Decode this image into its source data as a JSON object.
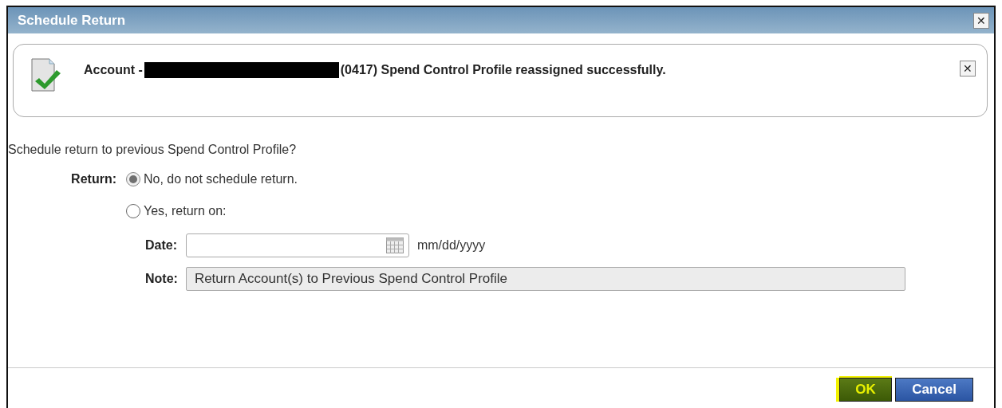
{
  "window": {
    "title": "Schedule Return",
    "close": "✕"
  },
  "message": {
    "prefix": "Account - ",
    "redacted": true,
    "text": "(0417) Spend Control Profile reassigned successfully.",
    "close": "✕"
  },
  "question": "Schedule return to previous Spend Control Profile?",
  "return": {
    "label": "Return:",
    "options": [
      {
        "label": "No, do not schedule return.",
        "selected": true
      },
      {
        "label": "Yes, return on:",
        "selected": false
      }
    ]
  },
  "date": {
    "label": "Date:",
    "format": "mm/dd/yyyy"
  },
  "note": {
    "label": "Note:",
    "value": "Return Account(s) to Previous Spend Control Profile",
    "disabled": true
  },
  "buttons": [
    {
      "label": "OK",
      "kind": "primary",
      "highlighted": true
    },
    {
      "label": "Cancel",
      "kind": "secondary",
      "highlighted": false
    }
  ]
}
